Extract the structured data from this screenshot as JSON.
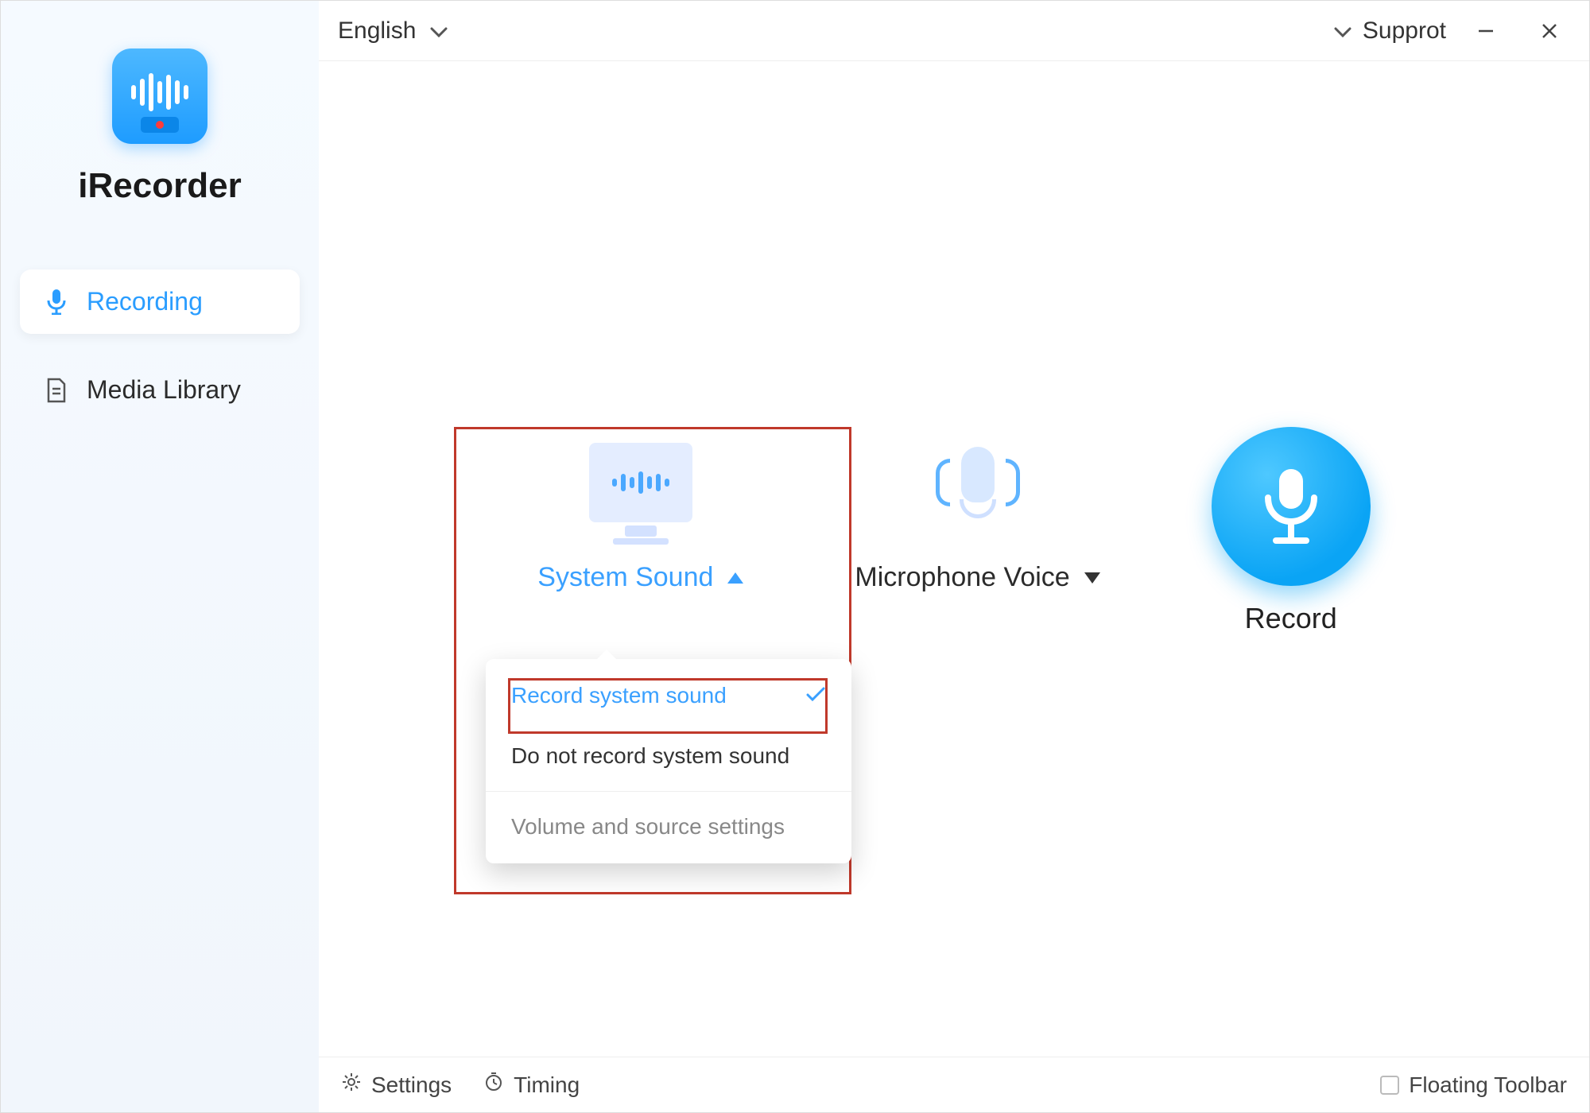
{
  "app": {
    "name": "iRecorder"
  },
  "topbar": {
    "language": "English",
    "support": "Supprot"
  },
  "sidebar": {
    "items": [
      {
        "label": "Recording",
        "active": true
      },
      {
        "label": "Media Library",
        "active": false
      }
    ]
  },
  "sources": {
    "system": {
      "label": "System Sound",
      "expanded": true
    },
    "mic": {
      "label": "Microphone Voice",
      "expanded": false
    },
    "dropdown": {
      "option_selected": "Record system sound",
      "option_off": "Do not record system sound",
      "settings": "Volume and source settings"
    }
  },
  "record": {
    "label": "Record"
  },
  "bottombar": {
    "settings": "Settings",
    "timing": "Timing",
    "floating": "Floating Toolbar"
  }
}
